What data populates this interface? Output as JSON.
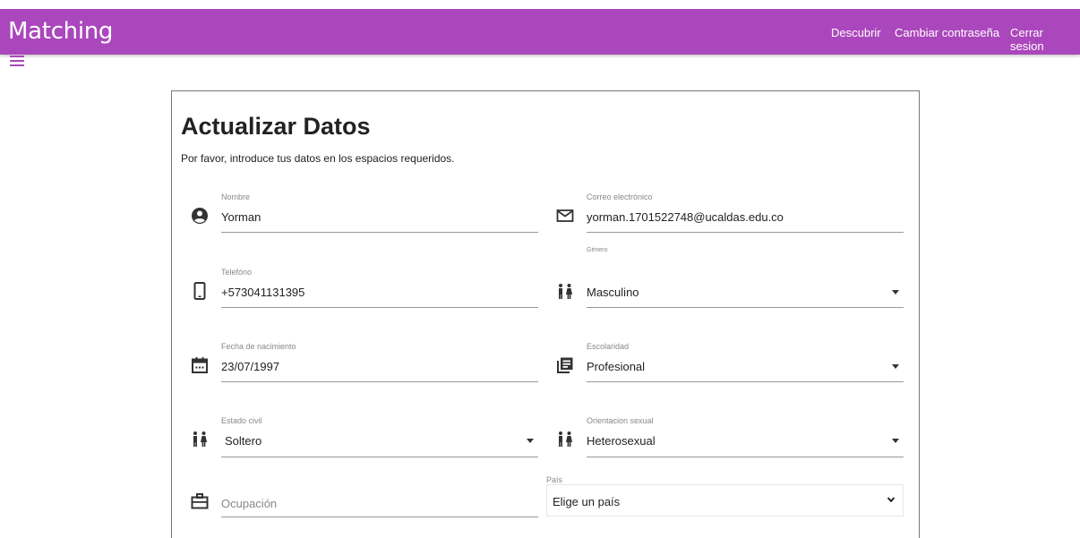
{
  "app": {
    "brand": "Matching"
  },
  "nav": {
    "discover": "Descubrir",
    "change_password": "Cambiar contraseña",
    "logout": "Cerrar sesion"
  },
  "form": {
    "title": "Actualizar Datos",
    "subtitle": "Por favor, introduce tus datos en los espacios requeridos.",
    "name": {
      "label": "Nombre",
      "value": "Yorman"
    },
    "email": {
      "label": "Correo electrónico",
      "value": "yorman.1701522748@ucaldas.edu.co"
    },
    "phone": {
      "label": "Telefóno",
      "value": "+573041131395"
    },
    "gender": {
      "label": "Género",
      "value": "Masculino"
    },
    "birthdate": {
      "label": "Fecha de nacimiento",
      "value": "23/07/1997"
    },
    "education": {
      "label": "Escolaridad",
      "value": "Profesional"
    },
    "civil_status": {
      "label": "Estado civil",
      "value": "Soltero"
    },
    "orientation": {
      "label": "Orientacion sexual",
      "value": "Heterosexual"
    },
    "occupation": {
      "placeholder": "Ocupación"
    },
    "country": {
      "label": "País",
      "value": "Elige un país"
    }
  },
  "colors": {
    "brand": "#ab47bc"
  },
  "icons": {
    "name": "account-circle-icon",
    "email": "mail-icon",
    "phone": "smartphone-icon",
    "gender": "people-icon",
    "birthdate": "calendar-icon",
    "education": "newspaper-icon",
    "civil_status": "people-icon",
    "orientation": "people-icon",
    "occupation": "briefcase-icon"
  }
}
